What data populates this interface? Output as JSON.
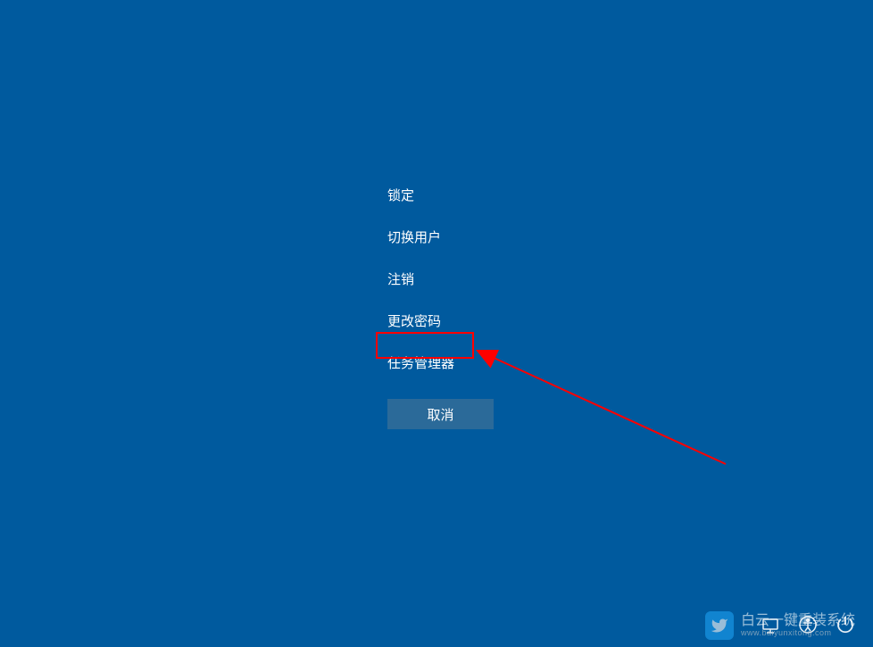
{
  "menu": {
    "lock": "锁定",
    "switch_user": "切换用户",
    "sign_out": "注销",
    "change_password": "更改密码",
    "task_manager": "任务管理器"
  },
  "cancel_label": "取消",
  "watermark": {
    "title": "白云一键重装系统",
    "url": "www.baiyunxitong.com"
  }
}
